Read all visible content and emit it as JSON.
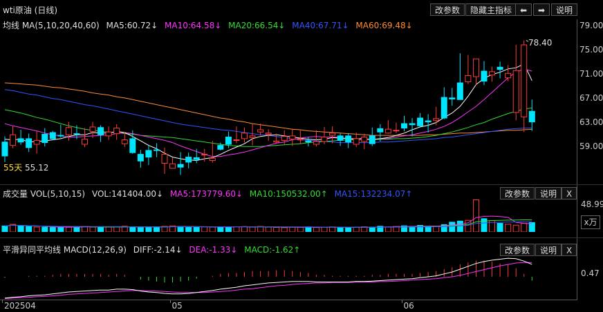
{
  "top": {
    "title": "wti原油 (日线)",
    "buttons": [
      "改参数",
      "隐藏主指标",
      "⬅",
      "➡",
      "说明"
    ]
  },
  "main": {
    "legend": [
      {
        "text": "均线 MA(5,10,20,40,60)",
        "color": "#e0e0e0"
      },
      {
        "text": "MA5:60.72↓",
        "color": "#e0e0e0"
      },
      {
        "text": "MA10:64.58↓",
        "color": "#ff33ff"
      },
      {
        "text": "MA20:66.54↓",
        "color": "#33dd33"
      },
      {
        "text": "MA40:67.71↓",
        "color": "#3355ff"
      },
      {
        "text": "MA60:69.48↓",
        "color": "#ff8c33"
      }
    ],
    "y_ticks": [
      "79.00",
      "75.00",
      "71.00",
      "67.00",
      "63.00",
      "59.00"
    ],
    "high_label": "78.40",
    "low_label": "55.12",
    "low_days_label": "55天"
  },
  "volume": {
    "legend": [
      {
        "text": "成交量 VOL(5,10,15)",
        "color": "#e0e0e0"
      },
      {
        "text": "VOL:141404.00↓",
        "color": "#e0e0e0"
      },
      {
        "text": "MA5:173779.60↓",
        "color": "#ff33ff"
      },
      {
        "text": "MA10:150532.00↑",
        "color": "#33dd33"
      },
      {
        "text": "MA15:132234.07↑",
        "color": "#3355ff"
      }
    ],
    "buttons": [
      "改参数",
      "说明",
      "X"
    ],
    "y_tick": "48.99",
    "unit": "x万"
  },
  "macd": {
    "legend": [
      {
        "text": "平滑异同平均线 MACD(12,26,9)",
        "color": "#e0e0e0"
      },
      {
        "text": "DIFF:-2.14↓",
        "color": "#e0e0e0"
      },
      {
        "text": "DEA:-1.33↓",
        "color": "#ff33ff"
      },
      {
        "text": "MACD:-1.62↑",
        "color": "#33dd33"
      }
    ],
    "buttons": [
      "改参数",
      "说明",
      "X"
    ],
    "y_tick": "0.47"
  },
  "x_labels": [
    "202504",
    "05",
    "06"
  ],
  "colors": {
    "up": "#ff3b3b",
    "down": "#00e5ff",
    "ma5": "#ffffff",
    "ma10": "#ff33ff",
    "ma20": "#33dd33",
    "ma40": "#3355ff",
    "ma60": "#ff8c33"
  },
  "chart_data": {
    "type": "candlestick",
    "close": [
      58.5,
      62.3,
      61.0,
      60.0,
      61.3,
      60.9,
      61.6,
      62.1,
      63.6,
      62.4,
      61.5,
      63.7,
      62.3,
      62.8,
      63.5,
      61.4,
      59.1,
      57.6,
      58.3,
      59.5,
      58.8,
      57.1,
      56.5,
      57.4,
      57.9,
      58.8,
      58.1,
      59.7,
      60.6,
      61.4,
      62.6,
      62.1,
      63.2,
      62.6,
      61.2,
      62.0,
      62.1,
      61.5,
      61.0,
      61.1,
      61.9,
      62.6,
      61.3,
      61.0,
      61.6,
      61.9,
      60.7,
      62.8,
      63.3,
      63.1,
      63.5,
      64.1,
      63.9,
      64.6,
      65.2,
      65.3,
      68.7,
      68.6,
      72.9,
      75.9,
      71.9,
      73.6,
      74.0,
      73.3,
      73.8,
      78.4,
      64.6
    ],
    "open": [
      61.0,
      60.4,
      61.6,
      61.6,
      60.6,
      62.4,
      62.7,
      62.2,
      62.3,
      62.5,
      60.6,
      62.9,
      63.6,
      62.1,
      62.5,
      60.7,
      61.6,
      58.8,
      59.5,
      59.6,
      57.2,
      56.3,
      57.0,
      58.3,
      58.2,
      58.8,
      57.7,
      60.4,
      61.9,
      61.3,
      61.6,
      61.8,
      62.8,
      62.4,
      61.0,
      61.3,
      61.5,
      61.5,
      61.2,
      60.6,
      61.1,
      62.2,
      62.1,
      62.1,
      60.6,
      61.1,
      62.1,
      63.4,
      62.6,
      63.0,
      64.3,
      64.3,
      65.3,
      64.8,
      64.9,
      69.0,
      68.9,
      71.6,
      71.8,
      72.7,
      73.7,
      73.0,
      74.4,
      72.5,
      66.3,
      65.5,
      66.5
    ],
    "high": [
      62.0,
      63.8,
      63.2,
      62.5,
      63.0,
      63.5,
      63.0,
      64.1,
      64.6,
      64.0,
      63.5,
      64.6,
      64.0,
      63.8,
      64.2,
      62.8,
      63.1,
      59.6,
      60.4,
      60.8,
      60.0,
      58.2,
      59.2,
      59.1,
      59.8,
      59.8,
      61.2,
      60.9,
      62.9,
      63.8,
      63.6,
      64.2,
      64.3,
      63.3,
      62.5,
      63.1,
      63.4,
      63.2,
      61.9,
      63.1,
      63.7,
      63.8,
      62.6,
      62.6,
      62.7,
      62.5,
      63.6,
      64.2,
      64.9,
      64.5,
      65.7,
      65.3,
      66.2,
      66.0,
      67.3,
      70.8,
      70.7,
      76.9,
      76.6,
      75.3,
      75.5,
      74.5,
      75.4,
      74.8,
      78.4,
      79.2,
      68.6
    ],
    "low": [
      57.4,
      59.9,
      60.5,
      59.2,
      58.9,
      60.2,
      61.3,
      61.8,
      61.2,
      61.5,
      60.1,
      61.7,
      61.0,
      61.4,
      61.4,
      60.1,
      58.9,
      56.4,
      56.9,
      58.3,
      55.3,
      56.3,
      55.1,
      56.3,
      57.2,
      57.5,
      57.3,
      59.5,
      59.9,
      60.8,
      60.9,
      60.4,
      62.2,
      61.2,
      60.8,
      60.6,
      60.3,
      60.6,
      60.2,
      60.2,
      60.6,
      60.8,
      60.3,
      59.9,
      60.1,
      59.7,
      60.3,
      61.1,
      62.5,
      62.6,
      62.9,
      62.0,
      63.6,
      62.7,
      64.0,
      65.1,
      67.5,
      69.2,
      71.4,
      71.2,
      71.2,
      71.8,
      72.4,
      71.9,
      64.9,
      62.8,
      63.0
    ],
    "ma5": [
      61.5,
      61.4,
      61.5,
      61.0,
      61.1,
      61.2,
      61.4,
      61.6,
      62.0,
      62.3,
      62.3,
      62.7,
      62.6,
      62.6,
      62.9,
      62.7,
      62.0,
      61.2,
      60.4,
      59.8,
      59.0,
      58.3,
      58.0,
      57.8,
      57.7,
      58.0,
      58.2,
      58.8,
      59.5,
      60.1,
      60.7,
      61.6,
      62.0,
      62.2,
      62.3,
      62.1,
      61.9,
      61.7,
      61.5,
      61.4,
      61.5,
      61.8,
      61.7,
      61.6,
      61.6,
      61.6,
      61.4,
      61.6,
      61.8,
      62.2,
      62.6,
      63.2,
      63.7,
      64.0,
      64.5,
      65.4,
      66.2,
      67.4,
      69.2,
      71.3,
      72.4,
      73.1,
      73.5,
      74.1,
      74.3,
      75.0,
      72.0
    ],
    "ma10": [
      64.3,
      63.9,
      63.6,
      63.3,
      63.0,
      62.6,
      62.3,
      62.1,
      61.9,
      61.9,
      62.0,
      62.1,
      62.2,
      62.3,
      62.5,
      62.7,
      62.5,
      62.2,
      61.9,
      61.6,
      61.3,
      60.9,
      60.3,
      59.8,
      59.3,
      58.8,
      58.4,
      58.4,
      58.7,
      58.9,
      59.2,
      59.6,
      60.0,
      60.4,
      60.8,
      61.0,
      61.4,
      61.7,
      61.9,
      62.0,
      61.9,
      61.9,
      61.8,
      61.6,
      61.5,
      61.5,
      61.5,
      61.6,
      61.6,
      61.9,
      62.1,
      62.3,
      62.6,
      62.9,
      63.3,
      63.8,
      64.5,
      65.4,
      66.4,
      67.4,
      68.6,
      69.9,
      71.2,
      72.5,
      73.5,
      74.1,
      73.7
    ],
    "ma20": [
      66.8,
      66.5,
      66.2,
      65.8,
      65.4,
      65.1,
      64.7,
      64.3,
      63.9,
      63.6,
      63.3,
      63.1,
      62.9,
      62.8,
      62.7,
      62.5,
      62.4,
      62.2,
      62.1,
      62.0,
      61.9,
      61.8,
      61.6,
      61.4,
      61.2,
      61.0,
      60.8,
      60.6,
      60.4,
      60.3,
      60.2,
      60.2,
      60.2,
      60.3,
      60.4,
      60.5,
      60.6,
      60.7,
      60.9,
      61.0,
      61.1,
      61.2,
      61.3,
      61.4,
      61.4,
      61.5,
      61.5,
      61.5,
      61.5,
      61.6,
      61.6,
      61.7,
      61.8,
      62.0,
      62.2,
      62.5,
      62.8,
      63.2,
      63.6,
      64.1,
      64.5,
      65.1,
      65.6,
      66.1,
      66.5,
      66.9,
      67.1
    ],
    "ma40": [
      70.4,
      70.2,
      69.9,
      69.6,
      69.4,
      69.1,
      68.8,
      68.6,
      68.3,
      68.0,
      67.7,
      67.5,
      67.2,
      66.9,
      66.6,
      66.3,
      66.0,
      65.7,
      65.4,
      65.1,
      64.8,
      64.5,
      64.2,
      64.0,
      63.8,
      63.6,
      63.4,
      63.2,
      63.1,
      62.9,
      62.7,
      62.5,
      62.3,
      62.2,
      62.0,
      61.8,
      61.6,
      61.4,
      61.3,
      61.2,
      61.1,
      61.0,
      60.9,
      60.9,
      60.9,
      60.9,
      60.9,
      61.0,
      61.0,
      61.1,
      61.2,
      61.3,
      61.4,
      61.5,
      61.6,
      61.8,
      61.9,
      62.1,
      62.3,
      62.5,
      62.7,
      62.9,
      63.1,
      63.3,
      63.4,
      63.5,
      63.5
    ],
    "ma60": [
      71.6,
      71.5,
      71.4,
      71.3,
      71.2,
      71.0,
      70.8,
      70.7,
      70.5,
      70.3,
      70.1,
      69.8,
      69.6,
      69.4,
      69.1,
      68.9,
      68.6,
      68.3,
      68.0,
      67.7,
      67.4,
      67.1,
      66.8,
      66.5,
      66.2,
      65.9,
      65.6,
      65.3,
      65.1,
      64.8,
      64.6,
      64.3,
      64.1,
      63.9,
      63.7,
      63.5,
      63.3,
      63.2,
      63.0,
      62.9,
      62.8,
      62.7,
      62.6,
      62.5,
      62.4,
      62.3,
      62.2,
      62.2,
      62.2,
      62.2,
      62.2,
      62.2,
      62.2,
      62.3,
      62.3,
      62.4,
      62.5,
      62.6,
      62.6,
      62.7,
      62.8,
      62.9,
      63.0,
      63.1,
      63.1,
      63.2,
      63.3
    ],
    "volume": [
      9.0,
      11.5,
      9.0,
      8.2,
      7.3,
      7.2,
      6.7,
      8.1,
      7.0,
      7.7,
      8.3,
      7.3,
      7.1,
      7.4,
      7.8,
      8.6,
      7.6,
      7.0,
      7.5,
      7.6,
      8.4,
      9.1,
      8.3,
      7.6,
      7.2,
      7.6,
      7.3,
      7.7,
      7.3,
      7.9,
      8.1,
      7.3,
      8.3,
      7.3,
      6.8,
      6.4,
      7.1,
      7.0,
      7.5,
      6.6,
      7.3,
      7.6,
      6.5,
      6.2,
      7.3,
      7.7,
      7.2,
      8.6,
      7.4,
      8.2,
      9.2,
      8.3,
      9.9,
      8.6,
      8.4,
      11.0,
      14.7,
      16.4,
      17.5,
      48.5,
      20.0,
      17.0,
      13.0,
      11.6,
      10.2,
      12.9,
      14.1
    ],
    "vol_ma5": [],
    "macd_diff": [
      -4.5,
      -4.3,
      -4.2,
      -4.0,
      -3.9,
      -3.8,
      -3.6,
      -3.4,
      -3.2,
      -3.1,
      -3.0,
      -2.9,
      -2.8,
      -2.8,
      -2.6,
      -2.6,
      -2.7,
      -3.0,
      -3.2,
      -3.3,
      -3.5,
      -3.6,
      -3.6,
      -3.5,
      -3.3,
      -3.1,
      -2.9,
      -2.6,
      -2.4,
      -2.2,
      -1.9,
      -1.7,
      -1.5,
      -1.3,
      -1.2,
      -1.1,
      -1.0,
      -1.0,
      -1.0,
      -1.1,
      -1.1,
      -1.1,
      -1.1,
      -1.1,
      -1.0,
      -1.0,
      -0.9,
      -0.8,
      -0.7,
      -0.6,
      -0.5,
      -0.4,
      -0.2,
      0.0,
      0.2,
      0.6,
      1.0,
      1.6,
      2.2,
      2.8,
      3.2,
      3.5,
      3.7,
      3.9,
      3.8,
      3.3,
      2.6
    ],
    "macd_dea": [
      -4.6,
      -4.5,
      -4.4,
      -4.3,
      -4.2,
      -4.1,
      -4.0,
      -3.9,
      -3.7,
      -3.6,
      -3.5,
      -3.4,
      -3.3,
      -3.2,
      -3.1,
      -3.0,
      -2.9,
      -2.9,
      -3.0,
      -3.0,
      -3.1,
      -3.2,
      -3.3,
      -3.3,
      -3.3,
      -3.3,
      -3.2,
      -3.1,
      -3.0,
      -2.8,
      -2.6,
      -2.5,
      -2.3,
      -2.1,
      -1.9,
      -1.8,
      -1.6,
      -1.5,
      -1.4,
      -1.3,
      -1.3,
      -1.2,
      -1.2,
      -1.2,
      -1.1,
      -1.1,
      -1.1,
      -1.0,
      -1.0,
      -0.9,
      -0.8,
      -0.7,
      -0.6,
      -0.5,
      -0.4,
      -0.2,
      0.0,
      0.3,
      0.7,
      1.1,
      1.5,
      1.9,
      2.3,
      2.6,
      2.9,
      3.0,
      3.0
    ],
    "ylim_price": [
      53.8,
      81.0
    ],
    "x_ticks": [
      {
        "index": 0,
        "label": "202504"
      },
      {
        "index": 21,
        "label": "05"
      },
      {
        "index": 50,
        "label": "06"
      }
    ]
  }
}
